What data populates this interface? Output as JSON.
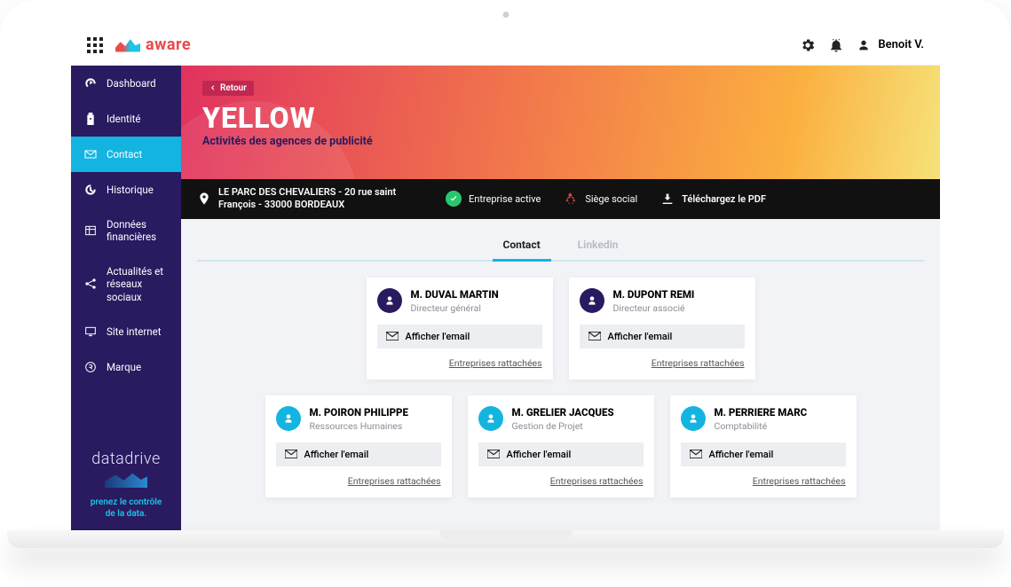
{
  "topbar": {
    "brand": "aware",
    "user_name": "Benoit V."
  },
  "sidebar": {
    "items": [
      {
        "label": "Dashboard"
      },
      {
        "label": "Identité"
      },
      {
        "label": "Contact"
      },
      {
        "label": "Historique"
      },
      {
        "label": "Données financières"
      },
      {
        "label": "Actualités et réseaux sociaux"
      },
      {
        "label": "Site internet"
      },
      {
        "label": "Marque"
      }
    ],
    "promo_brand": "datadrive",
    "promo_line1": "prenez le contrôle",
    "promo_line2": "de la data."
  },
  "hero": {
    "back": "Retour",
    "title": "YELLOW",
    "subtitle": "Activités des agences de publicité"
  },
  "infobar": {
    "address": "LE PARC DES CHEVALIERS  -  20 rue saint François - 33000 BORDEAUX",
    "status": "Entreprise active",
    "hq": "Siège social",
    "pdf": "Téléchargez le PDF"
  },
  "tabs": [
    {
      "label": "Contact",
      "active": true
    },
    {
      "label": "Linkedin",
      "active": false
    }
  ],
  "email_btn_label": "Afficher l'email",
  "linked_co_label": "Entreprises rattachées",
  "contacts_primary": [
    {
      "name": "M. DUVAL MARTIN",
      "role": "Directeur général"
    },
    {
      "name": "M. DUPONT REMI",
      "role": "Directeur associé"
    }
  ],
  "contacts_secondary": [
    {
      "name": "M. POIRON PHILIPPE",
      "role": "Ressources Humaines"
    },
    {
      "name": "M. GRELIER JACQUES",
      "role": "Gestion de Projet"
    },
    {
      "name": "M. PERRIERE MARC",
      "role": "Comptabilité"
    }
  ]
}
